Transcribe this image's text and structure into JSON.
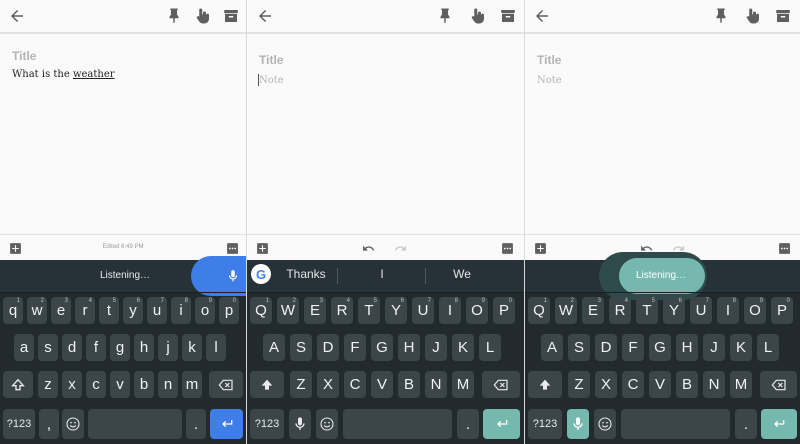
{
  "colors": {
    "keyboard_bg": "#232a2e",
    "key_bg": "#3c4549",
    "accent_blue": "#3f7ee8",
    "accent_teal": "#74b8ae"
  },
  "toolbar_icons": [
    "back-arrow-icon",
    "pin-icon",
    "hand-pointer-icon",
    "archive-icon"
  ],
  "panel1": {
    "title_placeholder": "Title",
    "note_text_start": "What is the ",
    "note_text_underlined": "weather",
    "edited_text": "Edited 6:49 PM",
    "listening_text": "Listening…",
    "keyboard": {
      "row1": [
        "q",
        "w",
        "e",
        "r",
        "t",
        "y",
        "u",
        "i",
        "o",
        "p"
      ],
      "row1_hints": [
        "1",
        "2",
        "3",
        "4",
        "5",
        "6",
        "7",
        "8",
        "9",
        "0"
      ],
      "row2": [
        "a",
        "s",
        "d",
        "f",
        "g",
        "h",
        "j",
        "k",
        "l"
      ],
      "row3": [
        "z",
        "x",
        "c",
        "v",
        "b",
        "n",
        "m"
      ],
      "symbols": "?123",
      "comma": ",",
      "period": "."
    }
  },
  "panel2": {
    "title_placeholder": "Title",
    "note_placeholder": "Note",
    "suggestions": [
      "Thanks",
      "I",
      "We"
    ],
    "keyboard": {
      "row1": [
        "Q",
        "W",
        "E",
        "R",
        "T",
        "Y",
        "U",
        "I",
        "O",
        "P"
      ],
      "row1_hints": [
        "1",
        "2",
        "3",
        "4",
        "5",
        "6",
        "7",
        "8",
        "9",
        "0"
      ],
      "row2": [
        "A",
        "S",
        "D",
        "F",
        "G",
        "H",
        "J",
        "K",
        "L"
      ],
      "row3": [
        "Z",
        "X",
        "C",
        "V",
        "B",
        "N",
        "M"
      ],
      "symbols": "?123",
      "period": "."
    }
  },
  "panel3": {
    "title_placeholder": "Title",
    "note_placeholder": "Note",
    "listening_text": "Listening…",
    "keyboard": {
      "row1": [
        "Q",
        "W",
        "E",
        "R",
        "T",
        "Y",
        "U",
        "I",
        "O",
        "P"
      ],
      "row1_hints": [
        "1",
        "2",
        "3",
        "4",
        "5",
        "6",
        "7",
        "8",
        "9",
        "0"
      ],
      "row2": [
        "A",
        "S",
        "D",
        "F",
        "G",
        "H",
        "J",
        "K",
        "L"
      ],
      "row3": [
        "Z",
        "X",
        "C",
        "V",
        "B",
        "N",
        "M"
      ],
      "symbols": "?123",
      "period": "."
    }
  }
}
